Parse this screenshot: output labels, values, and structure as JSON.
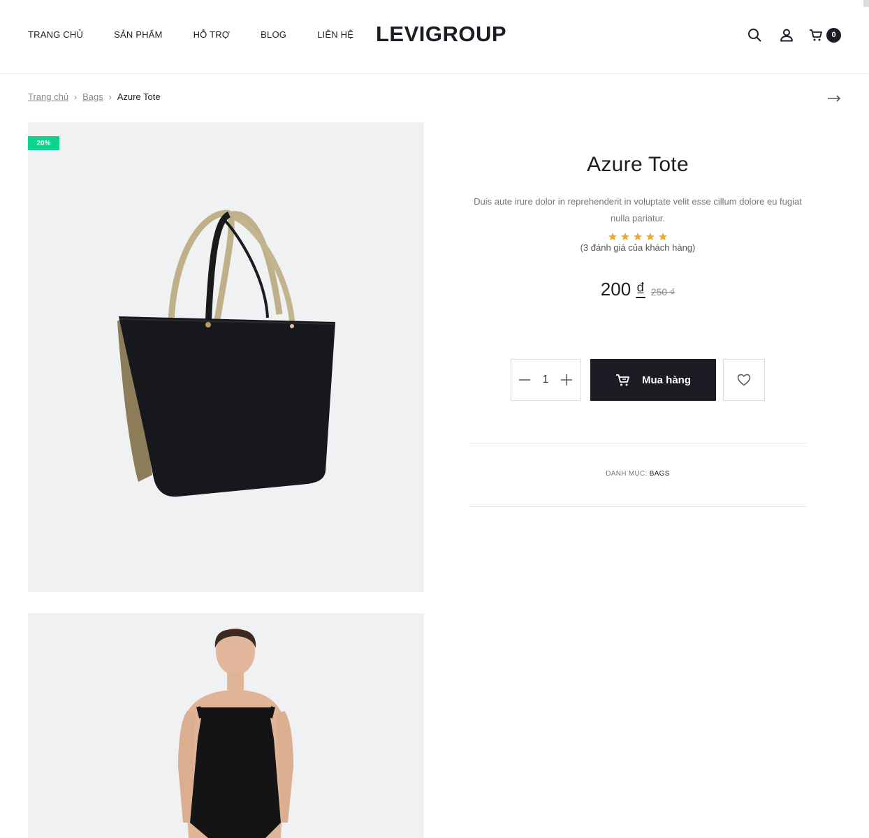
{
  "header": {
    "nav": [
      "TRANG CHỦ",
      "SẢN PHẨM",
      "HỖ TRỢ",
      "BLOG",
      "LIÊN HỆ"
    ],
    "logo": "LEVIGROUP",
    "cart_count": "0",
    "icons": [
      "search-icon",
      "user-icon",
      "cart-icon"
    ]
  },
  "breadcrumb": {
    "items": [
      "Trang chủ",
      "Bags"
    ],
    "current": "Azure Tote"
  },
  "gallery": {
    "sale_badge": "20%"
  },
  "product": {
    "title": "Azure Tote",
    "description": "Duis aute irure dolor in reprehenderit in voluptate velit esse cillum dolore eu fugiat nulla pariatur.",
    "rating": 5,
    "rating_max": 5,
    "reviews_text": "(3 đánh giá của khách hàng)",
    "price": "200",
    "currency": "₫",
    "old_price": "250 ₫",
    "quantity": "1",
    "buy_label": "Mua hàng",
    "category_label": "DANH MỤC:",
    "category": "BAGS"
  },
  "colors": {
    "accent_dark": "#1c1d24",
    "sale_green": "#0cd58b",
    "star_orange": "#f5a623"
  }
}
